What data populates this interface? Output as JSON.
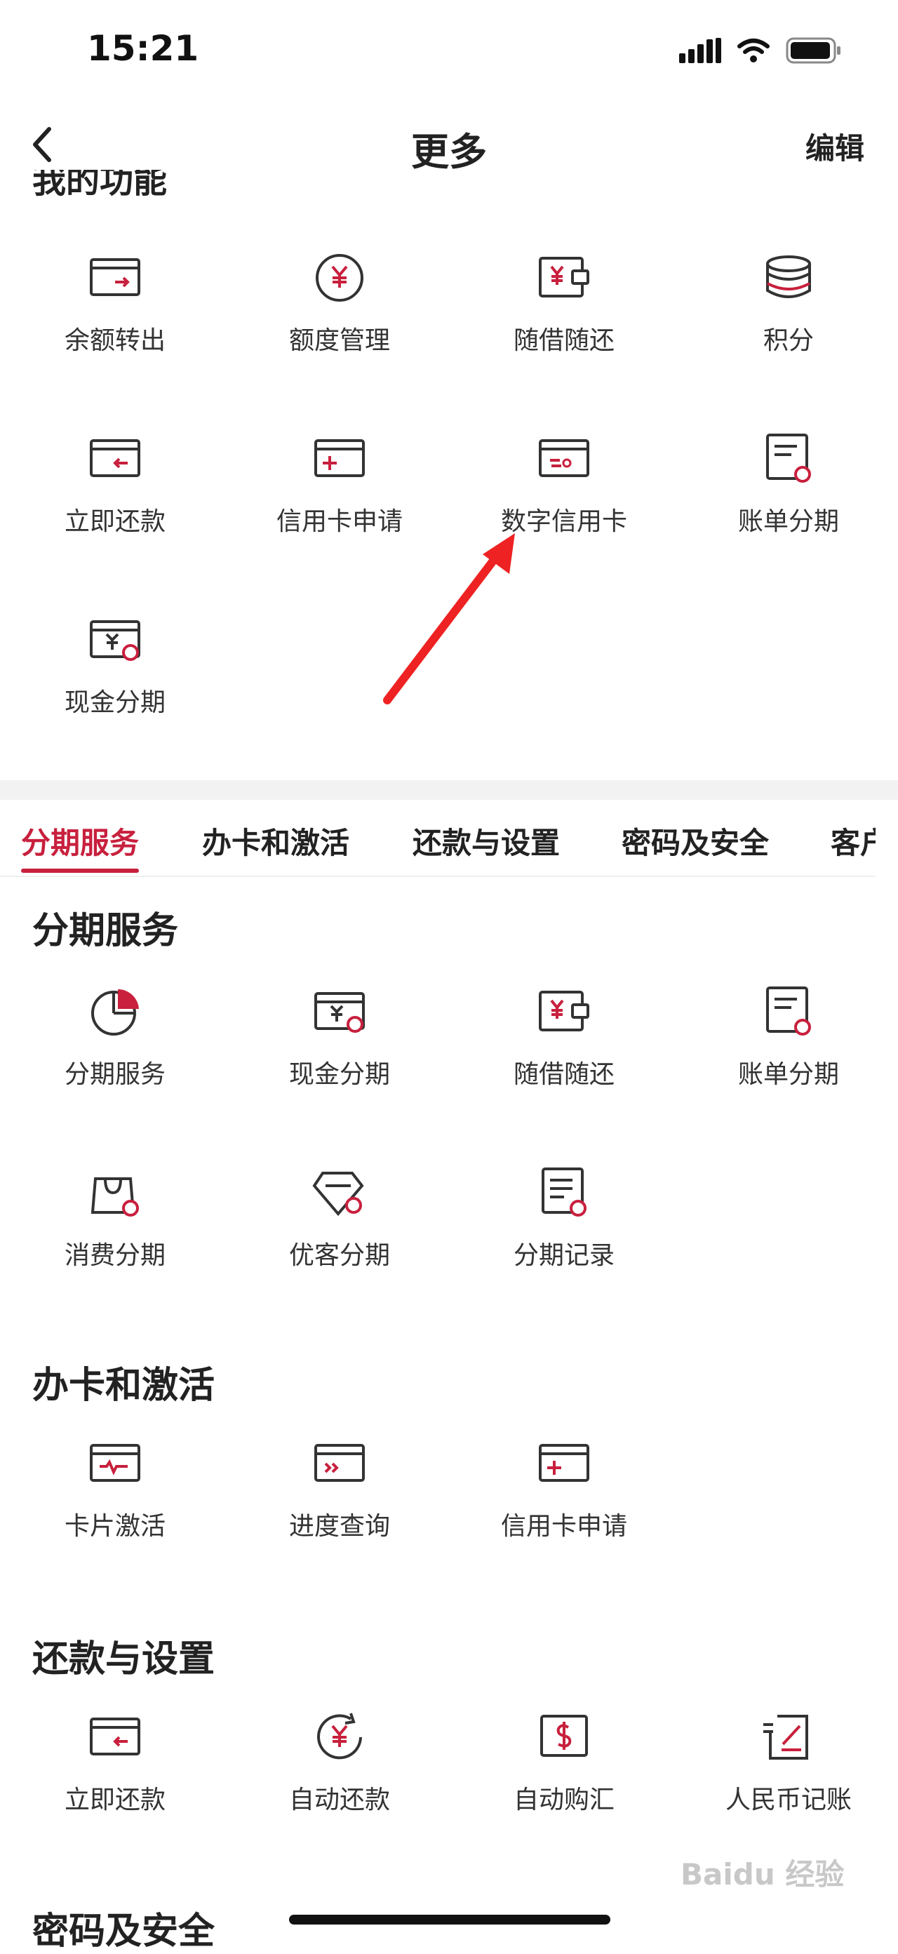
{
  "status_bar": {
    "time": "15:21"
  },
  "nav": {
    "title": "更多",
    "edit_label": "编辑"
  },
  "mine_section": {
    "title": "我的功能",
    "items": [
      {
        "label": "余额转出",
        "icon": "card-transfer-out-icon"
      },
      {
        "label": "额度管理",
        "icon": "yuan-limit-icon"
      },
      {
        "label": "随借随还",
        "icon": "wallet-yuan-icon"
      },
      {
        "label": "积分",
        "icon": "coin-stack-icon"
      },
      {
        "label": "立即还款",
        "icon": "card-repay-icon"
      },
      {
        "label": "信用卡申请",
        "icon": "card-apply-icon"
      },
      {
        "label": "数字信用卡",
        "icon": "digital-card-icon"
      },
      {
        "label": "账单分期",
        "icon": "bill-installment-icon"
      },
      {
        "label": "现金分期",
        "icon": "cash-installment-icon"
      }
    ]
  },
  "tabs": [
    "分期服务",
    "办卡和激活",
    "还款与设置",
    "密码及安全",
    "客户"
  ],
  "sections": [
    {
      "title": "分期服务",
      "items": [
        {
          "label": "分期服务",
          "icon": "pie-chart-icon"
        },
        {
          "label": "现金分期",
          "icon": "cash-installment-icon"
        },
        {
          "label": "随借随还",
          "icon": "wallet-yuan-icon"
        },
        {
          "label": "账单分期",
          "icon": "bill-installment-icon"
        },
        {
          "label": "消费分期",
          "icon": "shopping-bag-installment-icon"
        },
        {
          "label": "优客分期",
          "icon": "diamond-installment-icon"
        },
        {
          "label": "分期记录",
          "icon": "record-installment-icon"
        }
      ]
    },
    {
      "title": "办卡和激活",
      "items": [
        {
          "label": "卡片激活",
          "icon": "card-activate-icon"
        },
        {
          "label": "进度查询",
          "icon": "card-progress-icon"
        },
        {
          "label": "信用卡申请",
          "icon": "card-apply-icon"
        }
      ]
    },
    {
      "title": "还款与设置",
      "items": [
        {
          "label": "立即还款",
          "icon": "card-repay-icon"
        },
        {
          "label": "自动还款",
          "icon": "auto-repay-icon"
        },
        {
          "label": "自动购汇",
          "icon": "auto-exchange-icon"
        },
        {
          "label": "人民币记账",
          "icon": "rmb-ledger-icon"
        }
      ]
    },
    {
      "title": "密码及安全",
      "items": []
    }
  ],
  "watermark": {
    "text": "Baidu 经验"
  },
  "colors": {
    "accent": "#c8203d",
    "text": "#222222",
    "icon_stroke": "#333333"
  }
}
